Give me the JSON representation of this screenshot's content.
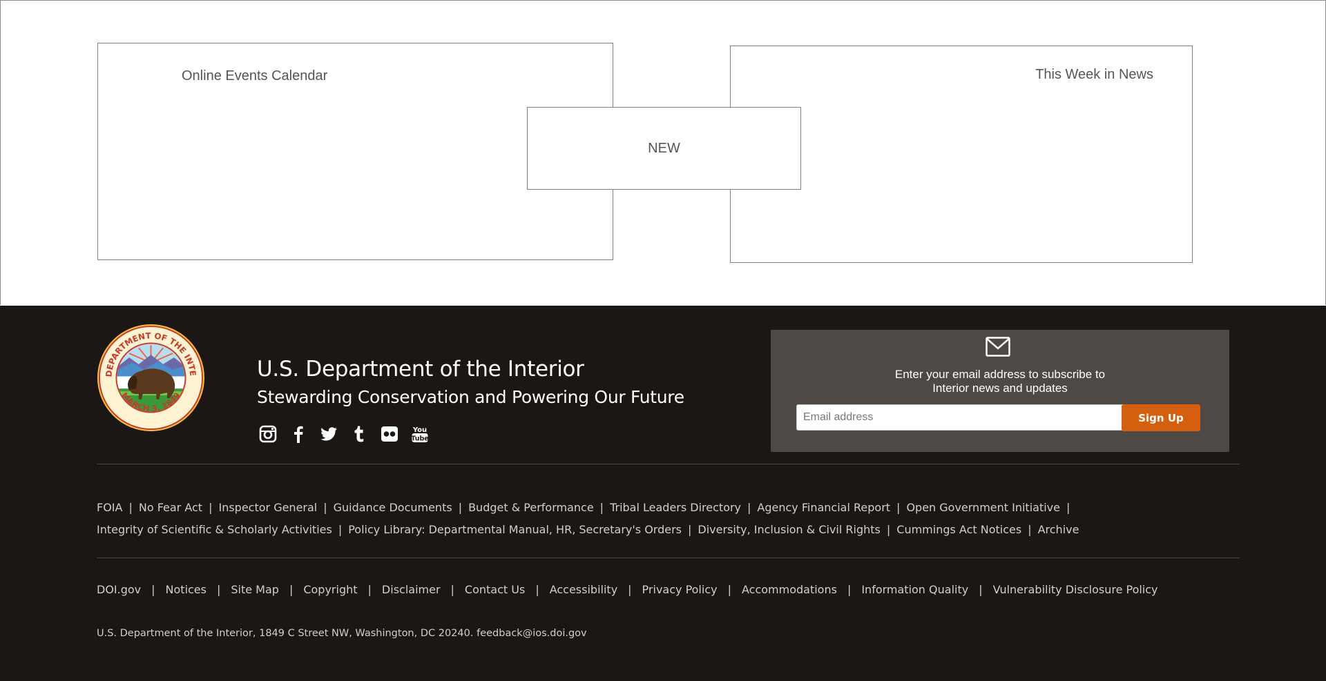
{
  "content": {
    "events_label": "Online Events Calendar",
    "news_label": "This Week in News",
    "new_label": "NEW"
  },
  "footer": {
    "title": "U.S. Department of the Interior",
    "tagline": "Stewarding Conservation and Powering Our Future",
    "seal": {
      "top_text": "U.S. DEPARTMENT OF THE INTERIOR",
      "bottom_text": "MARCH 3, 1849",
      "icon": "doi-seal-bison-icon"
    },
    "social": [
      "instagram-icon",
      "facebook-icon",
      "twitter-icon",
      "tumblr-icon",
      "flickr-icon",
      "youtube-icon"
    ],
    "youtube_text_1": "You",
    "youtube_text_2": "Tube",
    "subscribe": {
      "text_line1": "Enter your email address to subscribe to",
      "text_line2": "Interior news and updates",
      "email_placeholder": "Email address",
      "email_value": "",
      "signup_label": "Sign Up",
      "button_color": "#d4600f"
    },
    "links_row1": [
      "FOIA",
      "No Fear Act",
      "Inspector General",
      "Guidance Documents",
      "Budget & Performance",
      "Tribal Leaders Directory",
      "Agency Financial Report",
      "Open Government Initiative"
    ],
    "links_row2": [
      "Integrity of Scientific & Scholarly Activities",
      "Policy Library: Departmental Manual, HR, Secretary's Orders",
      "Diversity, Inclusion & Civil Rights",
      "Cummings Act Notices",
      "Archive"
    ],
    "links_row3": [
      "DOI.gov",
      "Notices",
      "Site Map",
      "Copyright",
      "Disclaimer",
      "Contact Us",
      "Accessibility",
      "Privacy Policy",
      "Accommodations",
      "Information Quality",
      "Vulnerability Disclosure Policy"
    ],
    "address": "U.S. Department of the Interior, 1849 C Street NW, Washington, DC 20240. feedback@ios.doi.gov",
    "separator": "|",
    "background_color": "#1c1714",
    "panel_color": "#4e4944"
  }
}
